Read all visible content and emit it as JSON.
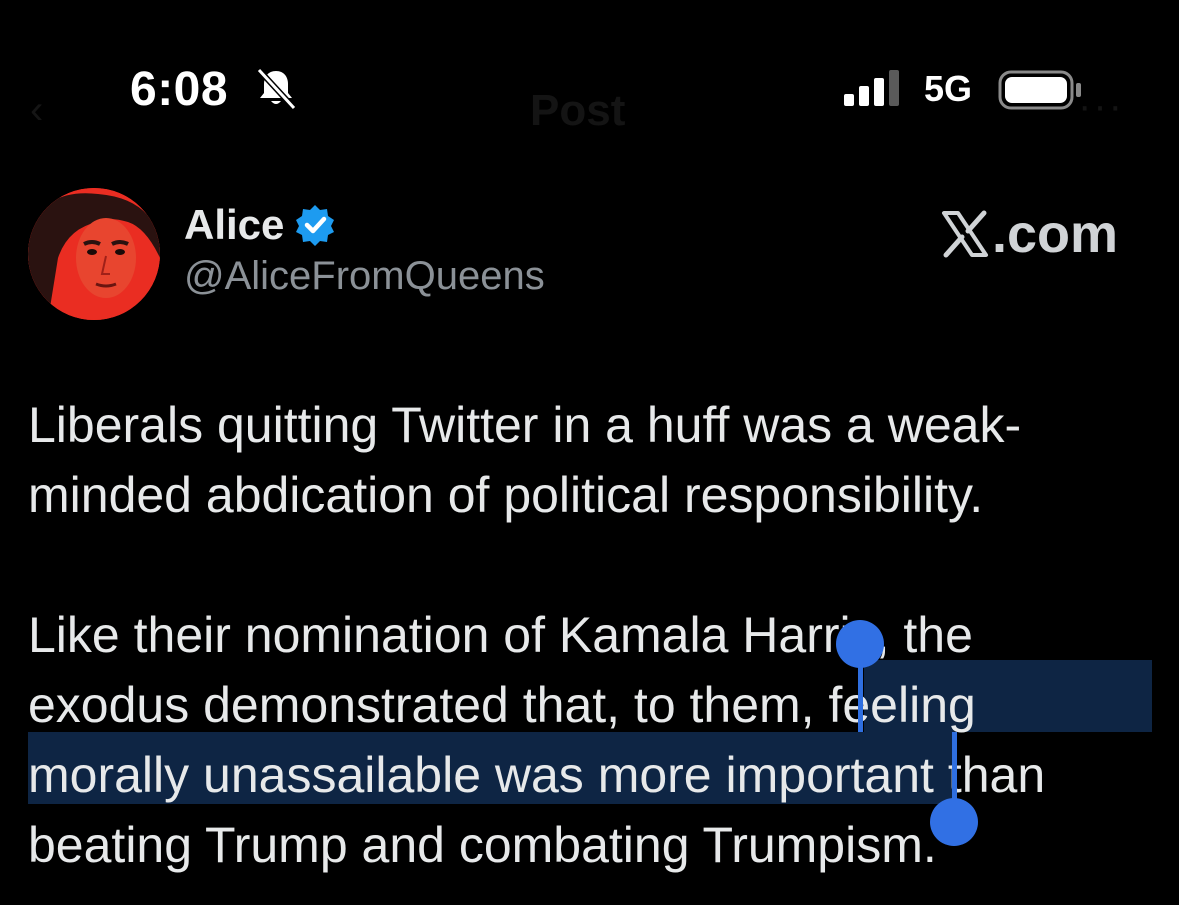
{
  "status_bar": {
    "time": "6:08",
    "network": "5G"
  },
  "nav_ghost": {
    "back": "‹",
    "title": "Post",
    "more": "···"
  },
  "post": {
    "author": {
      "display_name": "Alice",
      "handle": "@AliceFromQueens",
      "verified": true,
      "avatar_bg": "#ea2d22"
    },
    "watermark": "X.com",
    "lines": [
      "Liberals quitting Twitter in a huff was a weak-",
      "minded abdication of political responsibility.",
      "Like their nomination of Kamala Harris, the",
      "exodus demonstrated that, to them, feeling",
      "morally unassailable  was more important than",
      "beating Trump and combating Trumpism."
    ],
    "selection_text": "feeling morally unassailable  was more important"
  },
  "colors": {
    "background": "#000000",
    "text": "#e7e9ea",
    "secondary_text": "#8b9197",
    "verified_blue": "#1d9bf0",
    "selection_highlight": "#0e2544",
    "selection_handle": "#3170e4"
  },
  "icons": [
    "bell-slash-icon",
    "signal-icon",
    "battery-icon",
    "verified-badge-icon",
    "x-logo-icon"
  ]
}
